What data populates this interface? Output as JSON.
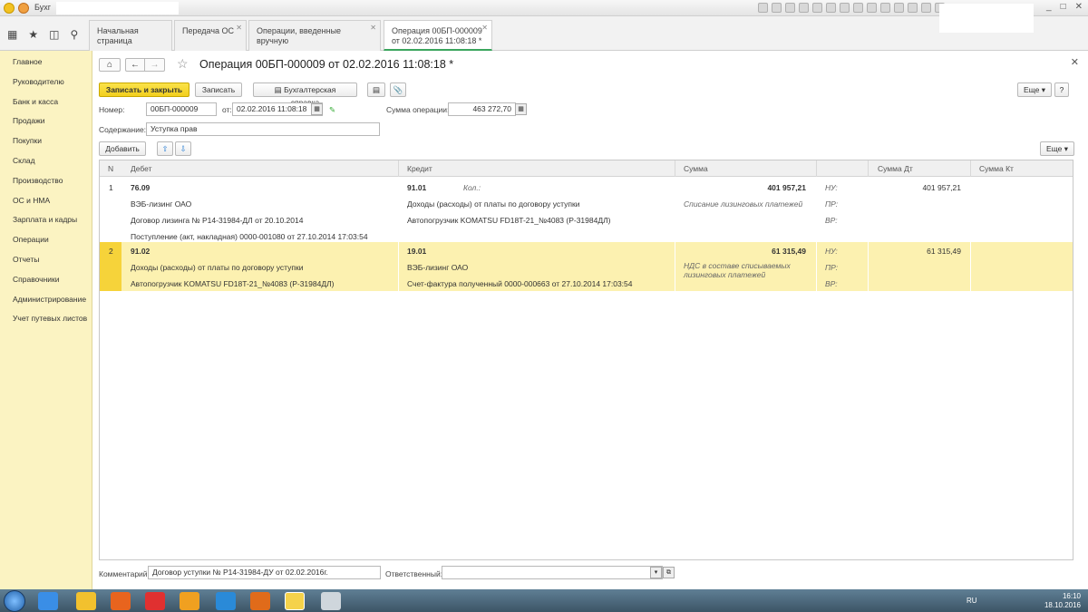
{
  "window": {
    "title": "Бухг",
    "buttons": [
      "_",
      "□",
      "✕"
    ]
  },
  "tabs": [
    {
      "label": "Начальная страница"
    },
    {
      "label": "Передача ОС"
    },
    {
      "label": "Операции, введенные вручную"
    },
    {
      "label": "Операция 00БП-000009",
      "label2": "от 02.02.2016 11:08:18 *"
    }
  ],
  "sidebar": {
    "items": [
      "Главное",
      "Руководителю",
      "Банк и касса",
      "Продажи",
      "Покупки",
      "Склад",
      "Производство",
      "ОС и НМА",
      "Зарплата и кадры",
      "Операции",
      "Отчеты",
      "Справочники",
      "Администрирование",
      "Учет путевых листов"
    ]
  },
  "document": {
    "title": "Операция 00БП-000009 от 02.02.2016 11:08:18 *",
    "toolbar": {
      "save_close": "Записать и закрыть",
      "save": "Записать",
      "report": "Бухгалтерская справка",
      "more": "Еще"
    },
    "fields": {
      "number_label": "Номер:",
      "number_value": "00БП-000009",
      "date_label": "от:",
      "date_value": "02.02.2016 11:08:18",
      "sum_label": "Сумма операции:",
      "sum_value": "463 272,70",
      "content_label": "Содержание:",
      "content_value": "Уступка прав"
    },
    "table_toolbar": {
      "add": "Добавить",
      "more": "Еще"
    },
    "columns": [
      "N",
      "Дебет",
      "Кредит",
      "Сумма",
      "Сумма Дт",
      "Сумма Кт"
    ],
    "rows": [
      {
        "n": "1",
        "debit": [
          "76.09",
          "ВЭБ-лизинг ОАО",
          "Договор лизинга № Р14-31984-ДЛ от 20.10.2014",
          "Поступление (акт, накладная) 0000-001080 от 27.10.2014 17:03:54"
        ],
        "credit": [
          "91.01",
          "Доходы (расходы) от платы по договору уступки",
          "Автопогрузчик KOMATSU FD18T-21_№4083 (Р-31984ДЛ)"
        ],
        "kol": "Кол.:",
        "sum": "401 957,21",
        "note": "Списание лизинговых платежей",
        "nu": "НУ:",
        "pr": "ПР:",
        "vr": "ВР:",
        "sum_dt": "401 957,21"
      },
      {
        "n": "2",
        "debit": [
          "91.02",
          "Доходы (расходы) от платы по договору уступки",
          "Автопогрузчик KOMATSU FD18T-21_№4083 (Р-31984ДЛ)"
        ],
        "credit": [
          "19.01",
          "ВЭБ-лизинг ОАО",
          "Счет-фактура полученный 0000-000663 от 27.10.2014 17:03:54"
        ],
        "sum": "61 315,49",
        "note": "НДС в составе списываемых лизинговых платежей",
        "nu": "НУ:",
        "pr": "ПР:",
        "vr": "ВР:",
        "sum_dt": "61 315,49"
      }
    ],
    "footer": {
      "comment_label": "Комментарий:",
      "comment_value": "Договор уступки № Р14-31984-ДУ от 02.02.2016г.",
      "responsible_label": "Ответственный:"
    }
  },
  "taskbar": {
    "lang": "RU",
    "time": "16:10",
    "date": "18.10.2016"
  }
}
